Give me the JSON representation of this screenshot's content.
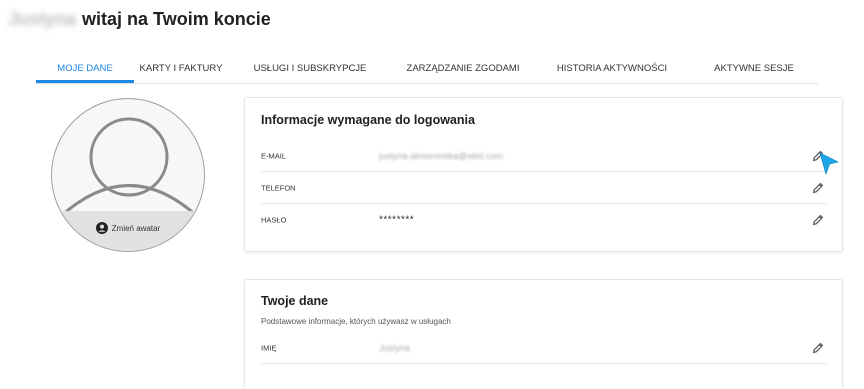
{
  "header": {
    "user_name": "Justyna",
    "greeting": "witaj na Twoim koncie"
  },
  "tabs": [
    {
      "label": "MOJE DANE",
      "active": true
    },
    {
      "label": "KARTY I FAKTURY",
      "active": false
    },
    {
      "label": "USŁUGI I SUBSKRYPCJE",
      "active": false
    },
    {
      "label": "ZARZĄDZANIE ZGODAMI",
      "active": false
    },
    {
      "label": "HISTORIA AKTYWNOŚCI",
      "active": false
    },
    {
      "label": "AKTYWNE SESJE",
      "active": false
    }
  ],
  "avatar": {
    "change_label": "Zmień awatar"
  },
  "login_card": {
    "title": "Informacje wymagane do logowania",
    "rows": [
      {
        "label": "E-MAIL",
        "value": "justyna.akowronska@wbd.com"
      },
      {
        "label": "TELEFON",
        "value": ""
      },
      {
        "label": "HASŁO",
        "value": "********"
      }
    ]
  },
  "data_card": {
    "title": "Twoje dane",
    "subtitle": "Podstawowe informacje, których używasz w usługach",
    "rows": [
      {
        "label": "IMIĘ",
        "value": "Justyna"
      }
    ]
  },
  "colors": {
    "accent": "#1e88e5",
    "cursor": "#1ea7e8",
    "text": "#212121",
    "divider": "#e6e6e6"
  },
  "icons": {
    "edit": "pencil-icon",
    "avatar_change": "user-circle-icon",
    "cursor": "mouse-pointer-icon"
  }
}
